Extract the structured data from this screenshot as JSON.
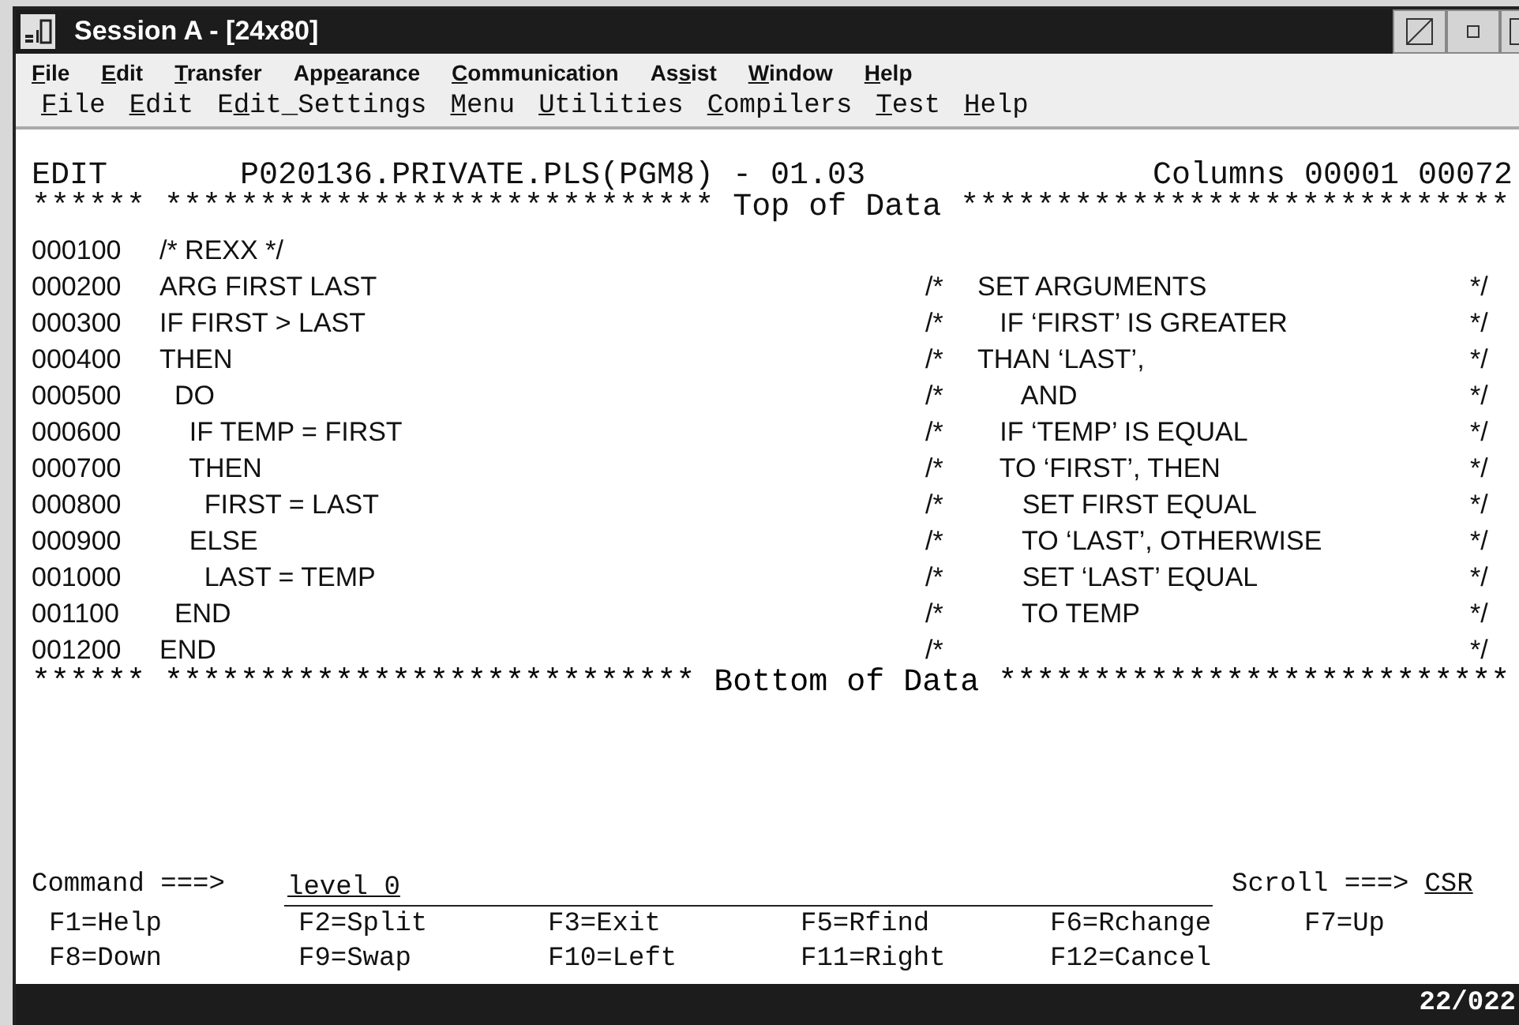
{
  "window": {
    "title": "Session A - [24x80]"
  },
  "menu_bar": [
    {
      "key": "F",
      "post": "ile"
    },
    {
      "key": "E",
      "post": "dit"
    },
    {
      "key": "T",
      "post": "ransfer"
    },
    {
      "pre": "App",
      "key": "e",
      "post": "arance"
    },
    {
      "key": "C",
      "post": "ommunication"
    },
    {
      "pre": "As",
      "key": "s",
      "post": "ist"
    },
    {
      "key": "W",
      "post": "indow"
    },
    {
      "key": "H",
      "post": "elp"
    }
  ],
  "action_bar": [
    {
      "key": "F",
      "post": "ile"
    },
    {
      "key": "E",
      "post": "dit"
    },
    {
      "pre": "E",
      "key": "d",
      "post": "it_Settings"
    },
    {
      "key": "M",
      "post": "enu"
    },
    {
      "key": "U",
      "post": "tilities"
    },
    {
      "key": "C",
      "post": "ompilers"
    },
    {
      "key": "T",
      "post": "est"
    },
    {
      "key": "H",
      "post": "elp"
    }
  ],
  "editor": {
    "mode": "EDIT",
    "dataset": "P020136.PRIVATE.PLS(PGM8) - 01.03",
    "columns": "Columns 00001 00072",
    "top_marker": "****** ***************************** Top of Data *****************************",
    "lines": [
      {
        "number": "000100",
        "code": "/* REXX */"
      },
      {
        "number": "000200",
        "code": "ARG FIRST LAST",
        "comment_open": "/*",
        "comment": "SET ARGUMENTS",
        "comment_close": "*/"
      },
      {
        "number": "000300",
        "code": "IF FIRST > LAST",
        "comment_open": "/*",
        "comment": "   IF ‘FIRST’ IS GREATER",
        "comment_close": "*/"
      },
      {
        "number": "000400",
        "code": "THEN",
        "comment_open": "/*",
        "comment": "THAN ‘LAST’,",
        "comment_close": "*/"
      },
      {
        "number": "000500",
        "code": "  DO",
        "comment_open": "/*",
        "comment": "      AND",
        "comment_close": "*/"
      },
      {
        "number": "000600",
        "code": "    IF TEMP = FIRST",
        "comment_open": "/*",
        "comment": "   IF ‘TEMP’ IS EQUAL",
        "comment_close": "*/"
      },
      {
        "number": "000700",
        "code": "    THEN",
        "comment_open": "/*",
        "comment": "   TO ‘FIRST’, THEN",
        "comment_close": "*/"
      },
      {
        "number": "000800",
        "code": "      FIRST = LAST",
        "comment_open": "/*",
        "comment": "      SET FIRST EQUAL",
        "comment_close": "*/"
      },
      {
        "number": "000900",
        "code": "    ELSE",
        "comment_open": "/*",
        "comment": "      TO ‘LAST’, OTHERWISE",
        "comment_close": "*/"
      },
      {
        "number": "001000",
        "code": "      LAST = TEMP",
        "comment_open": "/*",
        "comment": "      SET ‘LAST’ EQUAL",
        "comment_close": "*/"
      },
      {
        "number": "001100",
        "code": "  END",
        "comment_open": "/*",
        "comment": "      TO TEMP",
        "comment_close": "*/"
      },
      {
        "number": "001200",
        "code": "END",
        "comment_open": "/*",
        "comment_close": "*/"
      }
    ],
    "bottom_marker": "****** **************************** Bottom of Data ***************************"
  },
  "command": {
    "label": "Command ===>",
    "value": "level 0",
    "scroll_label": "Scroll ===>",
    "scroll_value": "CSR"
  },
  "function_keys": [
    [
      "F1=Help",
      "F2=Split",
      "F3=Exit",
      "F5=Rfind",
      "F6=Rchange",
      "F7=Up"
    ],
    [
      "F8=Down",
      "F9=Swap",
      "F10=Left",
      "F11=Right",
      "F12=Cancel"
    ]
  ],
  "status_bar": {
    "position": "22/022"
  }
}
